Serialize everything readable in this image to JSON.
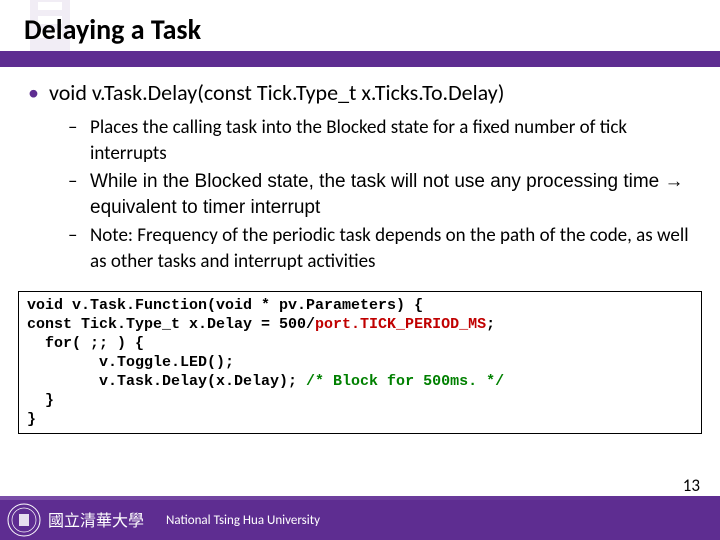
{
  "title": "Delaying a Task",
  "signature": "void v.Task.Delay(const Tick.Type_t x.Ticks.To.Delay)",
  "bullets": [
    "Places the calling task into the Blocked state for a fixed number of tick interrupts",
    "While in the Blocked state, the task will not use any processing time → equivalent to timer interrupt",
    "Note: Frequency of the periodic task depends on the path of the code, as well as other tasks and interrupt activities"
  ],
  "code": {
    "l1": "void v.Task.Function(void * pv.Parameters) {",
    "l2a": "const Tick.Type_t x.Delay = 500/",
    "l2b": "port.TICK_PERIOD_MS",
    "l2c": ";",
    "l3": "  for( ;; ) {",
    "l4": "        v.Toggle.LED();",
    "l5a": "        v.Task.Delay(x.Delay); ",
    "l5b": "/* Block for 500ms. */",
    "l6": "  }",
    "l7": "}"
  },
  "footer": "National Tsing Hua University",
  "page": "13"
}
